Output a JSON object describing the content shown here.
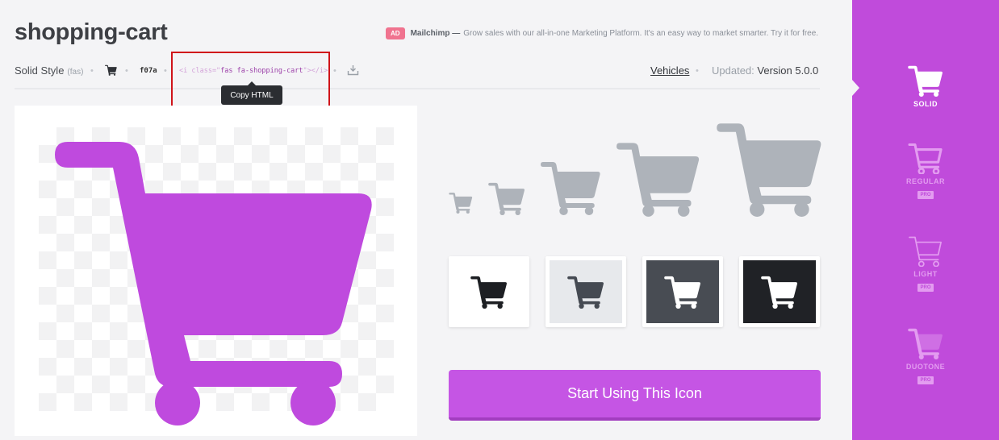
{
  "icon": {
    "name": "shopping-cart",
    "style_label": "Solid Style",
    "style_code": "(fas)",
    "unicode": "f07a",
    "html_snippet_open": "<i class=\"",
    "html_snippet_class": "fas fa-shopping-cart",
    "html_snippet_close": "\"></i>",
    "category": "Vehicles",
    "updated_label": "Updated:",
    "version": "Version 5.0.0",
    "separator": "•"
  },
  "tooltip": {
    "text": "Copy HTML"
  },
  "ad": {
    "badge": "AD",
    "brand": "Mailchimp —",
    "text": "Grow sales with our all-in-one Marketing Platform. It's an easy way to market smarter. Try it for free."
  },
  "cta": {
    "label": "Start Using This Icon"
  },
  "sidebar": {
    "styles": [
      {
        "label": "SOLID",
        "pro": ""
      },
      {
        "label": "REGULAR",
        "pro": "PRO"
      },
      {
        "label": "LIGHT",
        "pro": "PRO"
      },
      {
        "label": "DUOTONE",
        "pro": "PRO"
      }
    ]
  },
  "colors": {
    "accent": "#c04bdb",
    "icon_preview": "#bf4ade",
    "size_preview": "#aeb3ba",
    "highlight_box": "#d0141a"
  },
  "icons": {
    "preview": "shopping-cart-icon",
    "toolbar": [
      "shopping-cart-icon",
      "download-icon"
    ]
  }
}
